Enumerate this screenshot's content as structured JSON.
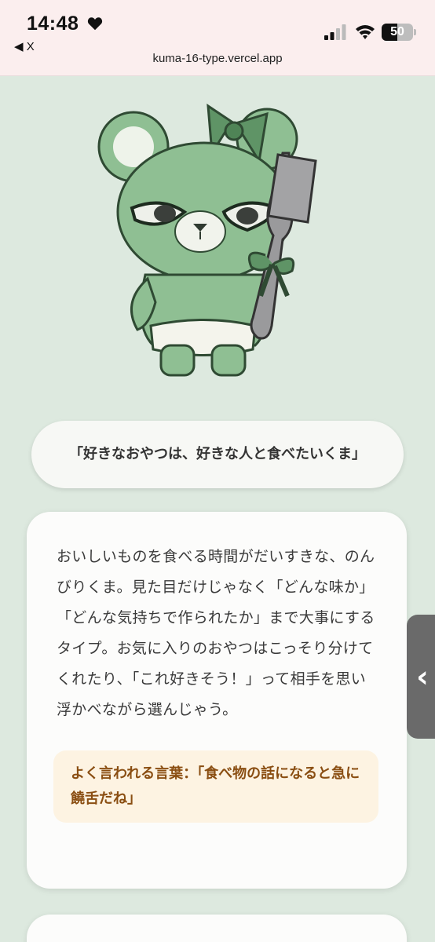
{
  "status_bar": {
    "time": "14:48",
    "battery": "50",
    "battery_level": 0.5,
    "back_label": "◀ X"
  },
  "browser": {
    "url": "kuma-16-type.vercel.app"
  },
  "quote": "「好きなおやつは、好きな人と食べたいくま」",
  "description": "おいしいものを食べる時間がだいすきな、のんびりくま。見た目だけじゃなく「どんな味か」「どんな気持ちで作られたか」まで大事にするタイプ。お気に入りのおやつはこっそり分けてくれたり、「これ好きそう！」って相手を思い浮かべながら選んじゃう。",
  "saying": "よく言われる言葉：「食べ物の話になると急に饒舌だね」",
  "colors": {
    "background": "#dde9df",
    "bear_green": "#8fbf93",
    "accent_brown": "#8a4e12"
  },
  "side_tab_icon": "‹"
}
